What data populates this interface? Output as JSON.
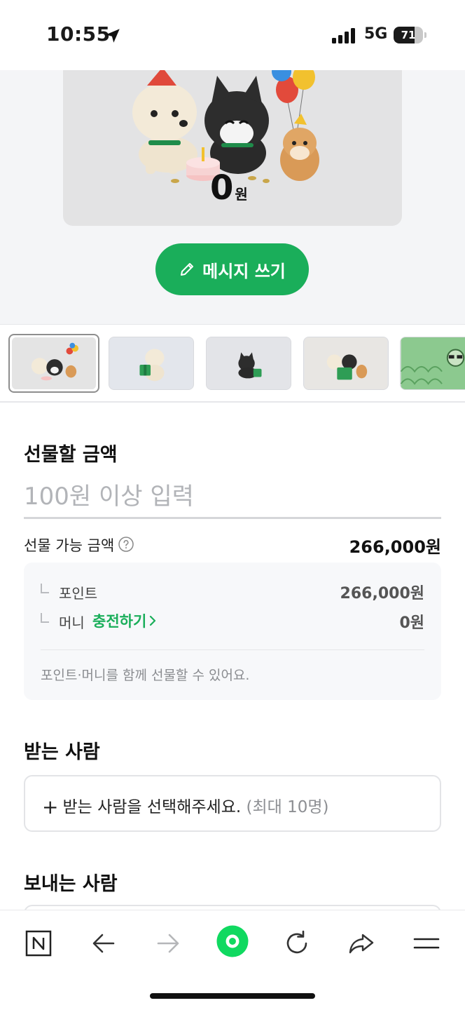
{
  "status_bar": {
    "time": "10:55",
    "network": "5G",
    "battery_percent": "71",
    "battery_level": 0.71
  },
  "preview": {
    "amount_value": "0",
    "amount_unit": "원",
    "write_message_label": "메시지 쓰기"
  },
  "thumbnails": [
    {
      "name": "party-animals",
      "selected": true
    },
    {
      "name": "puppy-gift",
      "selected": false
    },
    {
      "name": "kitten-gift",
      "selected": false
    },
    {
      "name": "friends-gift",
      "selected": false
    },
    {
      "name": "green-pattern",
      "selected": false
    }
  ],
  "gift_amount": {
    "title": "선물할 금액",
    "placeholder": "100원 이상 입력",
    "value": ""
  },
  "available": {
    "label": "선물 가능 금액",
    "value": "266,000원",
    "points_label": "포인트",
    "points_value": "266,000원",
    "money_label": "머니",
    "charge_label": "충전하기",
    "money_value": "0원",
    "note": "포인트·머니를 함께 선물할 수 있어요."
  },
  "recipient": {
    "title": "받는 사람",
    "plus": "+",
    "prompt": "받는 사람을 선택해주세요.",
    "hint": "(최대 10명)"
  },
  "sender": {
    "title": "보내는 사람"
  },
  "toolbar": {
    "items": [
      "naver-home",
      "back",
      "forward",
      "green-dot",
      "refresh",
      "share",
      "menu"
    ]
  },
  "colors": {
    "accent": "#1aae5a",
    "toolbar_dot": "#00de5a",
    "preview_bg": "#f4f5f7",
    "card_bg": "#e3e3e4"
  }
}
